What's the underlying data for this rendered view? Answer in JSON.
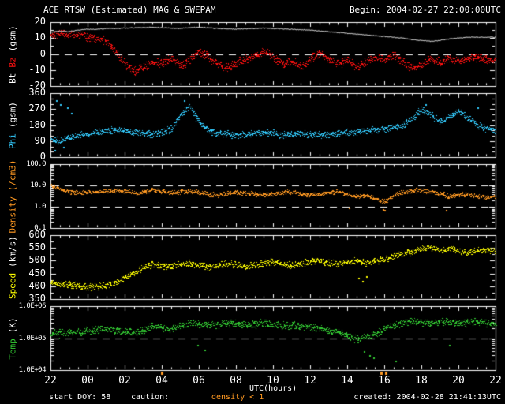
{
  "header": {
    "title": "ACE RTSW (Estimated) MAG & SWEPAM",
    "begin": "Begin: 2004-02-27 22:00:00UTC"
  },
  "footer": {
    "start_doy": "start DOY: 58",
    "caution_label": "caution:",
    "caution_value": "density < 1",
    "created": "created: 2004-02-28 21:41:13UTC"
  },
  "colors": {
    "background": "#000000",
    "frame": "#ffffff",
    "bt": "#ffffff",
    "bz": "#ff1111",
    "phi": "#33ccff",
    "density": "#ff9922",
    "speed": "#ffff00",
    "temp": "#33cc33",
    "caution": "#ff9922"
  },
  "x_axis": {
    "label": "UTC(hours)",
    "tick_labels": [
      "22",
      "00",
      "02",
      "04",
      "06",
      "08",
      "10",
      "12",
      "14",
      "16",
      "18",
      "20",
      "22"
    ],
    "hours_span": 24,
    "minor_tick_hours": 0.5,
    "major_tick_hours": 2
  },
  "caution_marks_hours": [
    6.0,
    17.85,
    18.1
  ],
  "chart_data": [
    {
      "id": "mag",
      "type": "scatter",
      "scale": "linear",
      "ylim": [
        -20,
        20
      ],
      "minor_step": 5,
      "dashed_lines": [
        0
      ],
      "small_labels": false,
      "ylabel_parts": [
        {
          "text": "Bt",
          "color": "#ffffff"
        },
        {
          "text": "Bz",
          "color": "#ff1111"
        },
        {
          "text": "(gsm)",
          "color": "#ffffff"
        }
      ],
      "yticks": [
        {
          "v": 20,
          "label": "20"
        },
        {
          "v": 10,
          "label": "10"
        },
        {
          "v": 0,
          "label": "0"
        },
        {
          "v": -10,
          "label": "-10"
        },
        {
          "v": -20,
          "label": "-20"
        }
      ],
      "series": [
        {
          "name": "Bz",
          "color": "#ff1111",
          "style": "scatter",
          "noise": 2.2,
          "t_step": 0.5,
          "values": [
            12.5,
            13,
            12,
            12.5,
            11,
            10,
            8,
            2,
            -6,
            -11,
            -8,
            -5,
            -6,
            -2,
            -7,
            -3,
            2,
            -2,
            -6,
            -9,
            -5,
            -3,
            -1,
            2,
            -2,
            -6,
            -4,
            -8,
            -3,
            1,
            -3,
            -6,
            -4,
            -8,
            -5,
            -2,
            -4,
            0,
            -5,
            -9,
            -7,
            -3,
            -5,
            -2,
            -4,
            -3,
            -2,
            -4,
            -3
          ],
          "outliers": []
        },
        {
          "name": "Bt",
          "color": "#ffffff",
          "style": "line",
          "noise": 0.25,
          "t_step": 0.5,
          "values": [
            13.5,
            14.5,
            14,
            15,
            15.5,
            15.5,
            16,
            16,
            16.2,
            16.5,
            16.5,
            16.8,
            16.5,
            16.2,
            16,
            16.5,
            16.8,
            16.5,
            16,
            15.8,
            15.5,
            15.8,
            16,
            16.2,
            16,
            15.8,
            15.5,
            15.2,
            15,
            14.5,
            14,
            13.5,
            13,
            12.5,
            12,
            11.5,
            11,
            10.5,
            10,
            9,
            8.5,
            8,
            8.5,
            9.5,
            10,
            10.5,
            10.5,
            10.5,
            10.5
          ],
          "outliers": []
        }
      ]
    },
    {
      "id": "phi",
      "type": "scatter",
      "scale": "linear",
      "ylim": [
        0,
        360
      ],
      "minor_step": 30,
      "dashed_lines": [],
      "small_labels": false,
      "ylabel_parts": [
        {
          "text": "Phi",
          "color": "#33ccff"
        },
        {
          "text": "(gsm)",
          "color": "#ffffff"
        }
      ],
      "yticks": [
        {
          "v": 360,
          "label": "360"
        },
        {
          "v": 270,
          "label": "270"
        },
        {
          "v": 180,
          "label": "180"
        },
        {
          "v": 90,
          "label": "90"
        },
        {
          "v": 0,
          "label": "0"
        }
      ],
      "series": [
        {
          "name": "Phi",
          "color": "#33ccff",
          "style": "scatter",
          "noise": 16,
          "t_step": 0.5,
          "values": [
            100,
            90,
            110,
            125,
            130,
            140,
            150,
            155,
            150,
            140,
            135,
            130,
            140,
            160,
            240,
            290,
            200,
            150,
            135,
            130,
            125,
            130,
            135,
            140,
            135,
            125,
            130,
            135,
            130,
            125,
            130,
            135,
            140,
            145,
            150,
            155,
            160,
            170,
            180,
            220,
            270,
            240,
            200,
            230,
            260,
            220,
            180,
            160,
            150
          ],
          "outliers": [
            [
              0.2,
              40
            ],
            [
              0.3,
              320
            ],
            [
              0.5,
              300
            ],
            [
              0.7,
              60
            ],
            [
              0.9,
              280
            ],
            [
              1.1,
              250
            ],
            [
              7.2,
              320
            ],
            [
              20.2,
              300
            ],
            [
              23.0,
              280
            ]
          ]
        }
      ]
    },
    {
      "id": "density",
      "type": "scatter",
      "scale": "log",
      "ylim": [
        0.1,
        100
      ],
      "minor_step": 0,
      "dashed_lines": [
        10,
        1
      ],
      "small_labels": true,
      "ylabel_parts": [
        {
          "text": "Density",
          "color": "#ff9922"
        },
        {
          "text": "(/cm3)",
          "color": "#ff9922"
        }
      ],
      "yticks": [
        {
          "v": 100,
          "label": "100.0"
        },
        {
          "v": 10,
          "label": "10.0"
        },
        {
          "v": 1,
          "label": "1.0"
        },
        {
          "v": 0.1,
          "label": "0.1"
        }
      ],
      "series": [
        {
          "name": "Density",
          "color": "#ff9922",
          "style": "scatter",
          "noise": 0.09,
          "t_step": 0.5,
          "values": [
            10,
            7,
            5,
            4.5,
            4.8,
            5.2,
            5.5,
            6,
            5.5,
            4.5,
            5,
            6.5,
            5.5,
            4.5,
            5,
            5.5,
            5,
            4,
            3.5,
            4.2,
            5,
            4.5,
            4,
            3.6,
            4.2,
            4.8,
            5,
            4.2,
            3.6,
            4,
            4.8,
            5.2,
            4,
            3,
            3.5,
            2.5,
            1.8,
            3.5,
            5,
            5.5,
            6,
            5.2,
            4.2,
            3.2,
            3.6,
            4,
            3.2,
            2.8,
            3.2
          ],
          "outliers": [
            [
              16.1,
              0.9
            ],
            [
              17.9,
              0.8
            ],
            [
              18.0,
              0.7
            ],
            [
              21.3,
              0.7
            ]
          ]
        }
      ]
    },
    {
      "id": "speed",
      "type": "scatter",
      "scale": "linear",
      "ylim": [
        350,
        600
      ],
      "minor_step": 25,
      "dashed_lines": [],
      "small_labels": false,
      "ylabel_parts": [
        {
          "text": "Speed",
          "color": "#ffff00"
        },
        {
          "text": "(km/s)",
          "color": "#ffffff"
        }
      ],
      "yticks": [
        {
          "v": 600,
          "label": "600"
        },
        {
          "v": 550,
          "label": "550"
        },
        {
          "v": 500,
          "label": "500"
        },
        {
          "v": 450,
          "label": "450"
        },
        {
          "v": 400,
          "label": "400"
        },
        {
          "v": 350,
          "label": "350"
        }
      ],
      "series": [
        {
          "name": "Speed",
          "color": "#ffff00",
          "style": "scatter",
          "noise": 11,
          "t_step": 0.5,
          "values": [
            415,
            410,
            408,
            402,
            398,
            400,
            405,
            415,
            435,
            455,
            475,
            488,
            482,
            478,
            488,
            492,
            483,
            476,
            481,
            490,
            486,
            479,
            484,
            492,
            496,
            488,
            483,
            490,
            497,
            502,
            494,
            488,
            495,
            500,
            492,
            498,
            508,
            518,
            528,
            538,
            548,
            552,
            542,
            548,
            538,
            532,
            540,
            546,
            540
          ],
          "outliers": [
            [
              16.6,
              432
            ],
            [
              16.8,
              420
            ],
            [
              17.0,
              440
            ]
          ]
        }
      ]
    },
    {
      "id": "temp",
      "type": "scatter",
      "scale": "log",
      "ylim": [
        10000,
        1000000
      ],
      "minor_step": 0,
      "dashed_lines": [
        100000
      ],
      "small_labels": true,
      "ylabel_parts": [
        {
          "text": "Temp",
          "color": "#33cc33"
        },
        {
          "text": "(K)",
          "color": "#ffffff"
        }
      ],
      "yticks": [
        {
          "v": 1000000,
          "label": "1.0E+06"
        },
        {
          "v": 100000,
          "label": "1.0E+05"
        },
        {
          "v": 10000,
          "label": "1.0E+04"
        }
      ],
      "series": [
        {
          "name": "Temp",
          "color": "#33cc33",
          "style": "scatter",
          "noise": 0.1,
          "t_step": 0.5,
          "values": [
            150000,
            140000,
            150000,
            160000,
            170000,
            180000,
            200000,
            180000,
            160000,
            150000,
            170000,
            250000,
            220000,
            200000,
            250000,
            300000,
            280000,
            250000,
            270000,
            300000,
            280000,
            260000,
            280000,
            300000,
            270000,
            250000,
            260000,
            240000,
            220000,
            200000,
            180000,
            150000,
            120000,
            95000,
            110000,
            130000,
            200000,
            250000,
            300000,
            350000,
            320000,
            300000,
            350000,
            320000,
            300000,
            320000,
            350000,
            300000,
            280000
          ],
          "outliers": [
            [
              7.9,
              60000
            ],
            [
              8.3,
              45000
            ],
            [
              16.9,
              40000
            ],
            [
              17.2,
              30000
            ],
            [
              17.4,
              25000
            ],
            [
              18.6,
              20000
            ],
            [
              21.5,
              60000
            ]
          ]
        }
      ]
    }
  ]
}
